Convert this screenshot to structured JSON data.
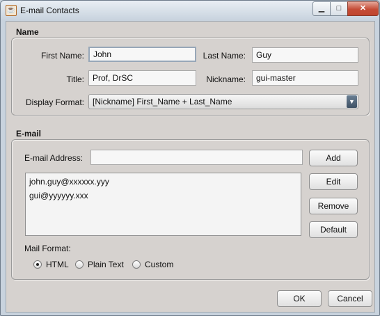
{
  "window": {
    "title": "E-mail Contacts",
    "icon": "java-cup-icon",
    "controls": {
      "minimize": "▁",
      "maximize": "□",
      "close": "✕"
    }
  },
  "name_section": {
    "title": "Name",
    "first_name": {
      "label": "First Name:",
      "value": "John"
    },
    "last_name": {
      "label": "Last Name:",
      "value": "Guy"
    },
    "title_field": {
      "label": "Title:",
      "value": "Prof, DrSC"
    },
    "nickname": {
      "label": "Nickname:",
      "value": "gui-master"
    },
    "display_format": {
      "label": "Display Format:",
      "selected": "[Nickname]  First_Name + Last_Name"
    }
  },
  "email_section": {
    "title": "E-mail",
    "address": {
      "label": "E-mail Address:",
      "value": ""
    },
    "emails": [
      "john.guy@xxxxxx.yyy",
      "gui@yyyyyy.xxx"
    ],
    "buttons": {
      "add": "Add",
      "edit": "Edit",
      "remove": "Remove",
      "default": "Default"
    },
    "mail_format": {
      "label": "Mail Format:",
      "options": [
        "HTML",
        "Plain Text",
        "Custom"
      ],
      "selected": "HTML"
    }
  },
  "footer": {
    "ok": "OK",
    "cancel": "Cancel"
  }
}
